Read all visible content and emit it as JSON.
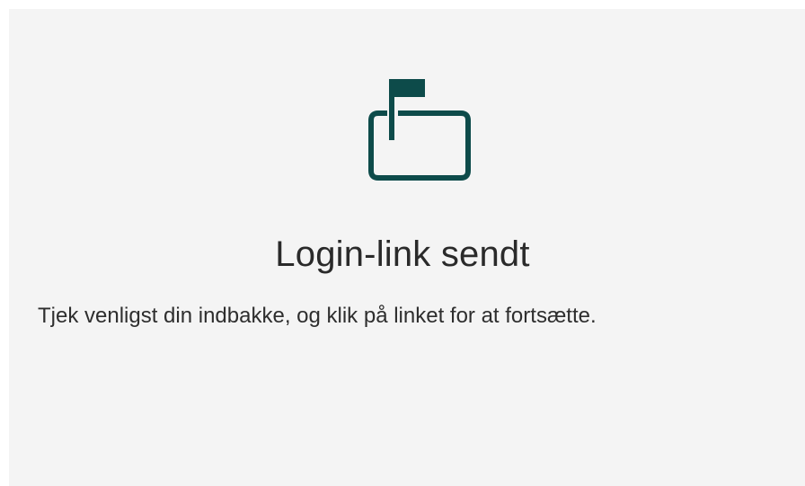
{
  "confirmation": {
    "icon": "mailbox-flag-icon",
    "icon_color": "#0d4b4a",
    "title": "Login-link sendt",
    "message": "Tjek venligst din indbakke, og klik på linket for at fortsætte."
  }
}
